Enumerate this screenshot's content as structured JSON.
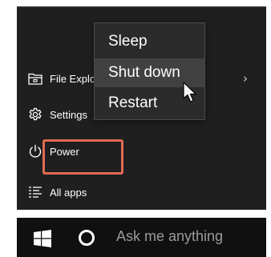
{
  "start_menu": {
    "items": [
      {
        "label": "File Explorer",
        "icon": "file-explorer-icon"
      },
      {
        "label": "Settings",
        "icon": "gear-icon"
      },
      {
        "label": "Power",
        "icon": "power-icon"
      },
      {
        "label": "All apps",
        "icon": "all-apps-icon"
      }
    ],
    "expand_icon": "chevron-right-icon"
  },
  "power_menu": {
    "options": [
      {
        "label": "Sleep"
      },
      {
        "label": "Shut down",
        "hovered": true
      },
      {
        "label": "Restart"
      }
    ]
  },
  "taskbar": {
    "start_icon": "windows-logo-icon",
    "cortana_icon": "cortana-circle-icon",
    "search_placeholder": "Ask me anything"
  },
  "colors": {
    "menu_background": "#1f1f1f",
    "popup_background": "#2b2b2b",
    "popup_hover": "#414141",
    "taskbar_background": "#101010",
    "highlight_border": "#e26a53",
    "text": "#ffffff",
    "placeholder_text": "#9a9a9a"
  }
}
